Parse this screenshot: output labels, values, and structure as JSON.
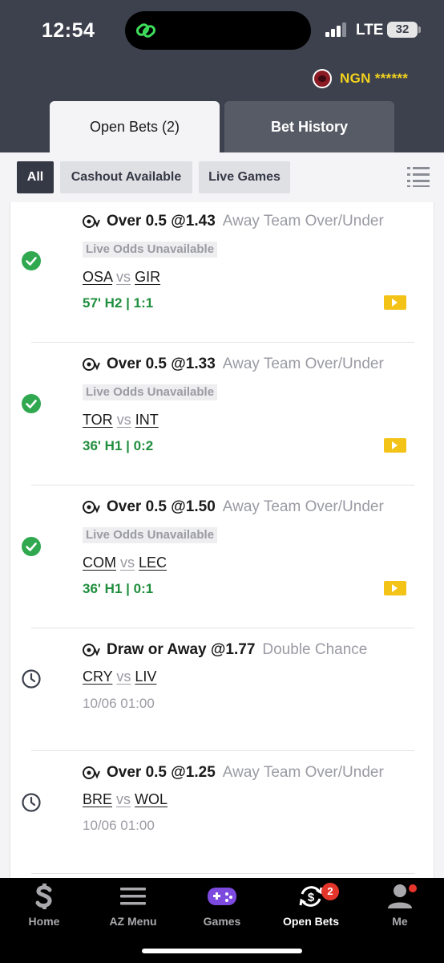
{
  "status": {
    "time": "12:54",
    "network": "LTE",
    "battery": "32"
  },
  "account": {
    "balance": "NGN ******"
  },
  "tabs": [
    {
      "label": "Open Bets (2)",
      "active": true
    },
    {
      "label": "Bet History",
      "active": false
    }
  ],
  "filters": [
    {
      "label": "All",
      "active": true
    },
    {
      "label": "Cashout Available",
      "active": false
    },
    {
      "label": "Live Games",
      "active": false
    }
  ],
  "bets": [
    {
      "status": "won-check-icon",
      "selection": "Over 0.5 @1.43",
      "market": "Away Team Over/Under",
      "odds_note": "Live Odds Unavailable",
      "home": "OSA",
      "vs": "vs",
      "away": "GIR",
      "clock": "57' H2 | ",
      "score": "1:1",
      "date": ""
    },
    {
      "status": "won-check-icon",
      "selection": "Over 0.5 @1.33",
      "market": "Away Team Over/Under",
      "odds_note": "Live Odds Unavailable",
      "home": "TOR",
      "vs": "vs",
      "away": "INT",
      "clock": "36' H1 | ",
      "score": "0:2",
      "date": ""
    },
    {
      "status": "won-check-icon",
      "selection": "Over 0.5 @1.50",
      "market": "Away Team Over/Under",
      "odds_note": "Live Odds Unavailable",
      "home": "COM",
      "vs": "vs",
      "away": "LEC",
      "clock": "36' H1 | ",
      "score": "0:1",
      "date": ""
    },
    {
      "status": "pending-clock-icon",
      "selection": "Draw or Away @1.77",
      "market": "Double Chance",
      "odds_note": "",
      "home": "CRY",
      "vs": "vs",
      "away": "LIV",
      "clock": "",
      "score": "",
      "date": "10/06 01:00"
    },
    {
      "status": "pending-clock-icon",
      "selection": "Over 0.5 @1.25",
      "market": "Away Team Over/Under",
      "odds_note": "",
      "home": "BRE",
      "vs": "vs",
      "away": "WOL",
      "clock": "",
      "score": "",
      "date": "10/06 01:00"
    }
  ],
  "nav": [
    {
      "label": "Home",
      "icon": "home-s-icon"
    },
    {
      "label": "AZ Menu",
      "icon": "menu-icon"
    },
    {
      "label": "Games",
      "icon": "gamepad-icon"
    },
    {
      "label": "Open Bets",
      "icon": "open-bets-icon",
      "badge": "2",
      "active": true
    },
    {
      "label": "Me",
      "icon": "profile-icon"
    }
  ],
  "colors": {
    "header": "#3d414d",
    "accent_green": "#1f8e3d",
    "balance_yellow": "#f3d31c",
    "badge_red": "#e4352b"
  }
}
